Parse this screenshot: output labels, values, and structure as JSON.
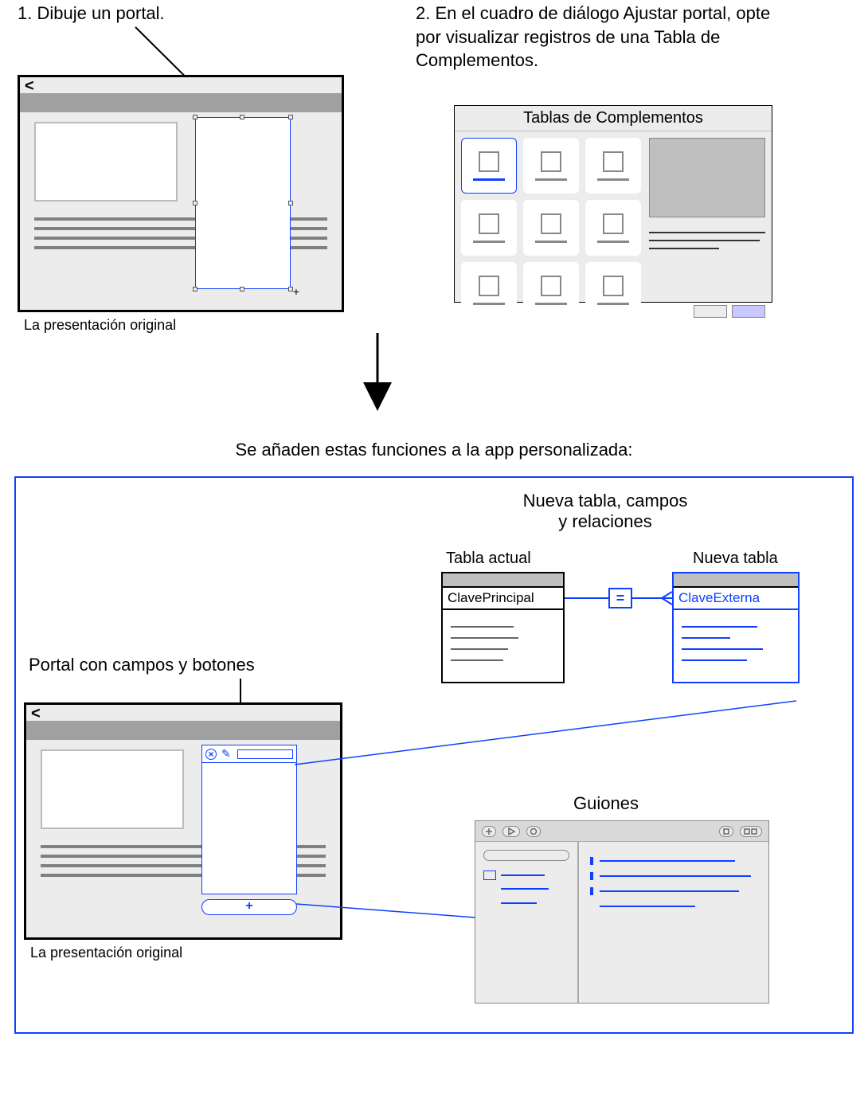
{
  "step1": {
    "text": "1. Dibuje un portal.",
    "caption": "La presentación original",
    "back_label": "<"
  },
  "step2": {
    "text": "2. En el cuadro de diálogo Ajustar portal, opte por visualizar registros de una Tabla de Complementos.",
    "dialog_title": "Tablas de Complementos"
  },
  "intro": "Se añaden estas funciones a la app personalizada:",
  "tables": {
    "heading": "Nueva tabla, campos\ny relaciones",
    "current_label": "Tabla actual",
    "new_label": "Nueva tabla",
    "current_key": "ClavePrincipal",
    "new_key": "ClaveExterna",
    "operator": "="
  },
  "portal_label": "Portal con campos y botones",
  "layout2": {
    "back_label": "<",
    "caption": "La presentación original",
    "add_symbol": "+",
    "delete_symbol": "×",
    "edit_symbol": "✎"
  },
  "scripts": {
    "heading": "Guiones"
  },
  "colors": {
    "accent": "#1040ff",
    "gray_fill": "#ececec",
    "gray_mid": "#a0a0a0"
  }
}
